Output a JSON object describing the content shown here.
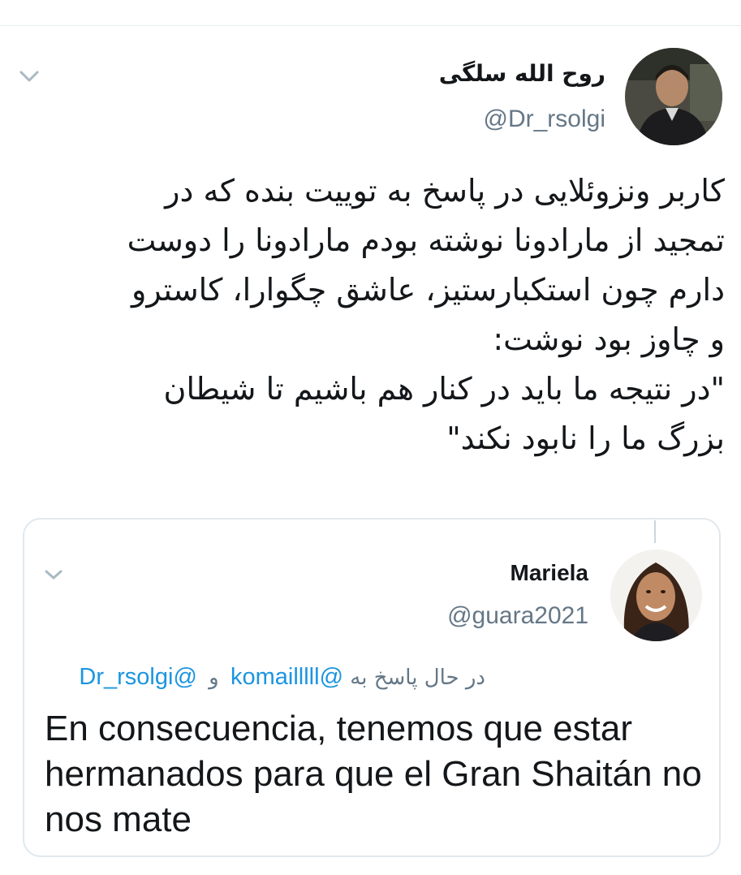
{
  "main_tweet": {
    "display_name": "روح الله سلگی",
    "handle": "@Dr_rsolgi",
    "text": "کاربر ونزوئلایی در پاسخ به توییت بنده که در\nتمجید از مارادونا نوشته بودم مارادونا را دوست\nدارم چون استکبارستیز، عاشق چگوارا، کاسترو\nو چاوز بود نوشت:\n\"در نتیجه ما باید در کنار هم باشیم تا شیطان\nبزرگ ما را نابود نکند\""
  },
  "quoted_tweet": {
    "display_name": "Mariela",
    "handle": "@guara2021",
    "reply_prefix": "در حال پاسخ به",
    "reply_mention_1": "@komailllll",
    "reply_conjunction": "و",
    "reply_mention_2": "@Dr_rsolgi",
    "text": "En consecuencia, tenemos que estar hermanados para que el Gran Shaitán no nos mate"
  },
  "icons": {
    "menu": "chevron-down-icon"
  },
  "colors": {
    "text_primary": "#14171a",
    "text_secondary": "#657786",
    "link": "#1b95e0",
    "border": "#e1e8ed"
  }
}
